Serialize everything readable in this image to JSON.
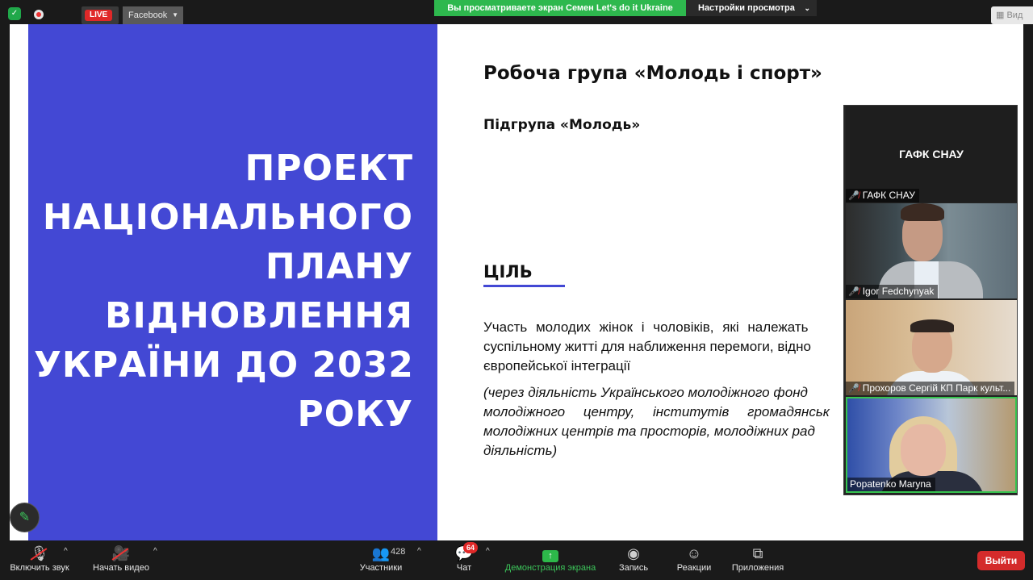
{
  "topbar": {
    "live_label": "LIVE",
    "platform_label": "Facebook",
    "share_banner": "Вы просматриваете экран Семен Let's do it Ukraine",
    "view_settings": "Настройки просмотра",
    "view_button": "Вид"
  },
  "slide": {
    "left_title_lines": [
      "ПРОЕКТ",
      "НАЦІОНАЛЬНОГО",
      "ПЛАНУ",
      "ВІДНОВЛЕННЯ",
      "УКРАЇНИ ДО 2032",
      "РОКУ"
    ],
    "heading": "Робоча група «Молодь і спорт»",
    "subheading": "Підгрупа «Молодь»",
    "goal_heading": "ЦІЛЬ",
    "goal_lines": [
      "Участь молодих жінок і чоловіків, які належать",
      "суспільному житті для наближення перемоги, відно",
      "європейської інтеграції"
    ],
    "italic_lines": [
      "(через діяльність Українського молодіжного фонд",
      "молодіжного центру, інститутів громадянськ",
      "молодіжних центрів та просторів, молодіжних рад",
      "діяльність)"
    ],
    "accent_color": "#4348d4"
  },
  "participants": [
    {
      "name": "ГАФК СНАУ",
      "tile_title": "ГАФК СНАУ",
      "muted": true
    },
    {
      "name": "Igor Fedchynyak",
      "muted": true
    },
    {
      "name": "Прохоров Сергій КП Парк культ...",
      "muted": true
    },
    {
      "name": "Popatenko Maryna",
      "muted": false,
      "speaking": true
    }
  ],
  "toolbar": {
    "mic_label": "Включить звук",
    "video_label": "Начать видео",
    "participants_label": "Участники",
    "participants_count": "428",
    "chat_label": "Чат",
    "chat_badge": "64",
    "share_label": "Демонстрация экрана",
    "record_label": "Запись",
    "reactions_label": "Реакции",
    "apps_label": "Приложения",
    "leave_label": "Выйти"
  }
}
